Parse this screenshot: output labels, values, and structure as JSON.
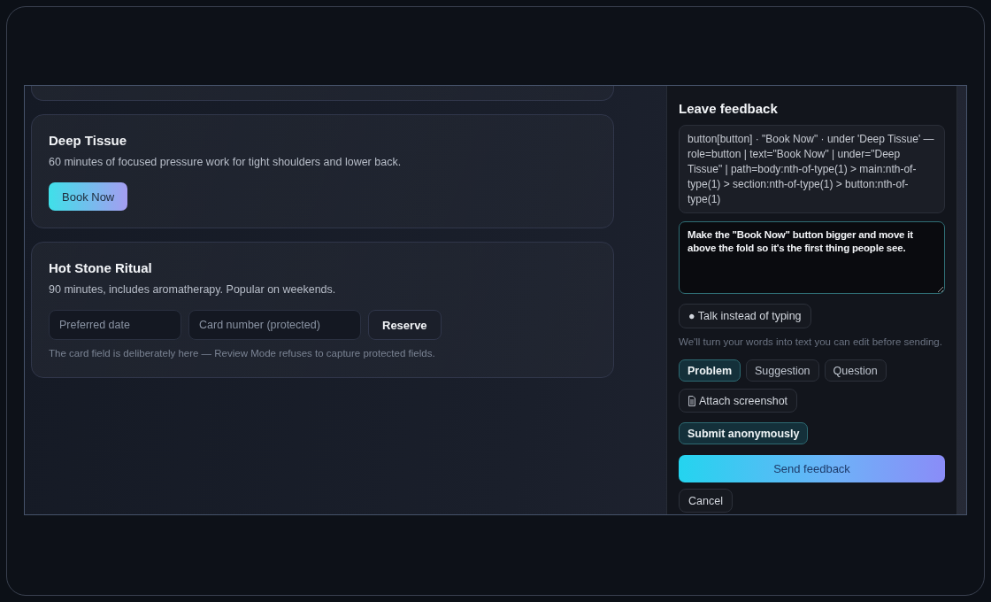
{
  "services": [
    {
      "kind": "clipped"
    },
    {
      "kind": "booking",
      "title": "Deep Tissue",
      "description": "60 minutes of focused pressure work for tight shoulders and lower back.",
      "button": "Book Now"
    },
    {
      "kind": "reservation",
      "title": "Hot Stone Ritual",
      "description": "90 minutes, includes aromatherapy. Popular on weekends.",
      "fields": [
        {
          "placeholder": "Preferred date"
        },
        {
          "placeholder": "Card number (protected)"
        }
      ],
      "button": "Reserve",
      "note": "The card field is deliberately here — Review Mode refuses to capture protected fields."
    }
  ],
  "review_panel": {
    "title": "Leave feedback",
    "target": "button[button] · \"Book Now\" · under 'Deep Tissue' — role=button | text=\"Book Now\" | under=\"Deep Tissue\" | path=body:nth-of-type(1) > main:nth-of-type(1) > section:nth-of-type(1) > button:nth-of-type(1)",
    "message": {
      "value": "Make the \"Book Now\" button bigger and move it above the fold so it's the first thing people see."
    },
    "voice_button": "● Talk instead of typing",
    "voice_hint": "We'll turn your words into text you can edit before sending.",
    "categories": [
      {
        "label": "Problem",
        "selected": true
      },
      {
        "label": "Suggestion",
        "selected": false
      },
      {
        "label": "Question",
        "selected": false
      }
    ],
    "attach_button": "Attach screenshot",
    "anonymous": {
      "label": "Submit anonymously",
      "on": true
    },
    "submit_button": "Send feedback",
    "cancel_button": "Cancel"
  }
}
